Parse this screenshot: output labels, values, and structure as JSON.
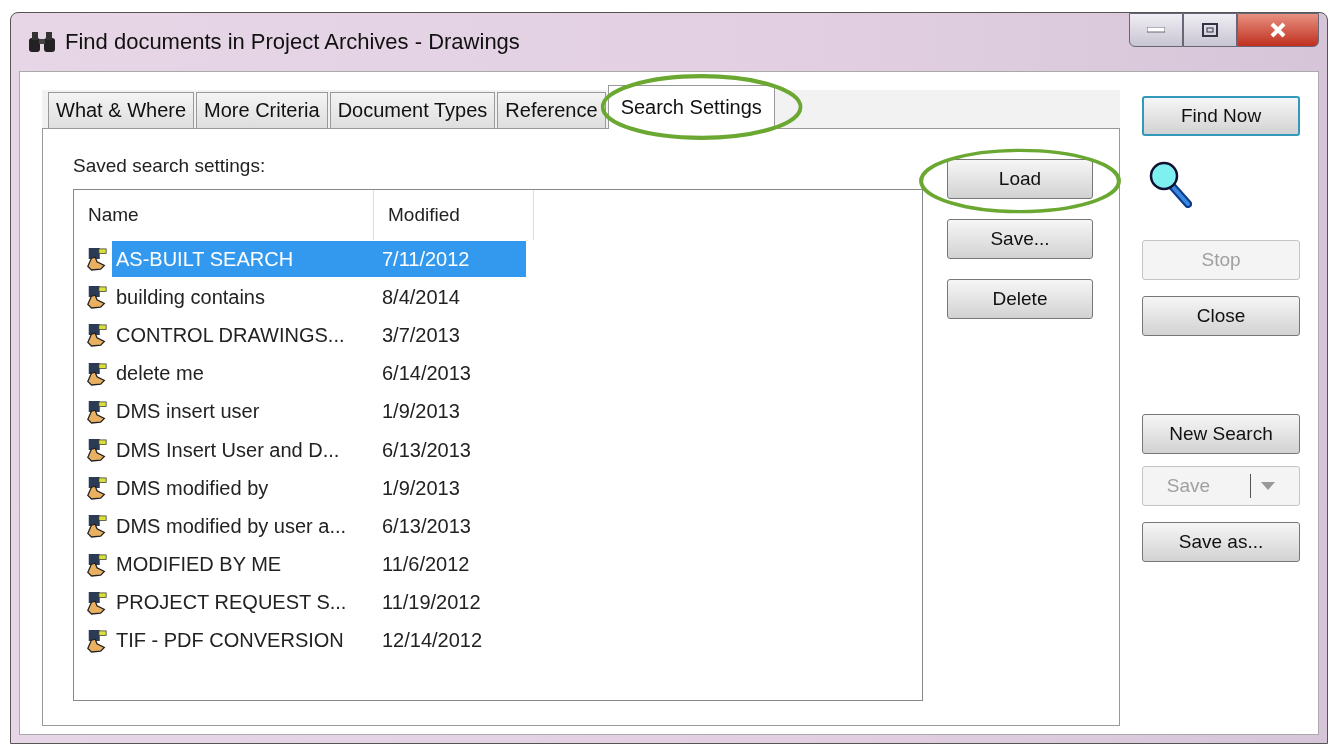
{
  "window": {
    "title": "Find documents in Project Archives - Drawings"
  },
  "tabs": [
    {
      "label": "What & Where",
      "selected": false,
      "highlighted": false
    },
    {
      "label": "More Criteria",
      "selected": false,
      "highlighted": false
    },
    {
      "label": "Document Types",
      "selected": false,
      "highlighted": false
    },
    {
      "label": "Reference",
      "selected": false,
      "highlighted": false
    },
    {
      "label": "Search Settings",
      "selected": true,
      "highlighted": true
    }
  ],
  "saved_label": "Saved search settings:",
  "table": {
    "columns": [
      "Name",
      "Modified"
    ],
    "rows": [
      {
        "name": "AS-BUILT SEARCH",
        "modified": "7/11/2012",
        "selected": true
      },
      {
        "name": "building contains",
        "modified": "8/4/2014",
        "selected": false
      },
      {
        "name": "CONTROL DRAWINGS...",
        "modified": "3/7/2013",
        "selected": false
      },
      {
        "name": "delete me",
        "modified": "6/14/2013",
        "selected": false
      },
      {
        "name": "DMS insert user",
        "modified": "1/9/2013",
        "selected": false
      },
      {
        "name": "DMS Insert User and D...",
        "modified": "6/13/2013",
        "selected": false
      },
      {
        "name": "DMS modified by",
        "modified": "1/9/2013",
        "selected": false
      },
      {
        "name": "DMS modified by user a...",
        "modified": "6/13/2013",
        "selected": false
      },
      {
        "name": "MODIFIED BY ME",
        "modified": "11/6/2012",
        "selected": false
      },
      {
        "name": "PROJECT REQUEST S...",
        "modified": "11/19/2012",
        "selected": false
      },
      {
        "name": "TIF - PDF CONVERSION",
        "modified": "12/14/2012",
        "selected": false
      }
    ]
  },
  "settings_buttons": [
    {
      "label": "Load",
      "highlighted": true
    },
    {
      "label": "Save...",
      "highlighted": false
    },
    {
      "label": "Delete",
      "highlighted": false
    }
  ],
  "side_buttons": [
    {
      "label": "Find Now",
      "kind": "default"
    },
    {
      "kind": "magnifier"
    },
    {
      "label": "Stop",
      "kind": "plain",
      "disabled": true
    },
    {
      "label": "Close",
      "kind": "plain",
      "disabled": false
    },
    {
      "kind": "spacer"
    },
    {
      "label": "New Search",
      "kind": "plain",
      "disabled": false
    },
    {
      "label": "Save",
      "kind": "split",
      "disabled": true
    },
    {
      "label": "Save as...",
      "kind": "plain",
      "disabled": false
    }
  ]
}
